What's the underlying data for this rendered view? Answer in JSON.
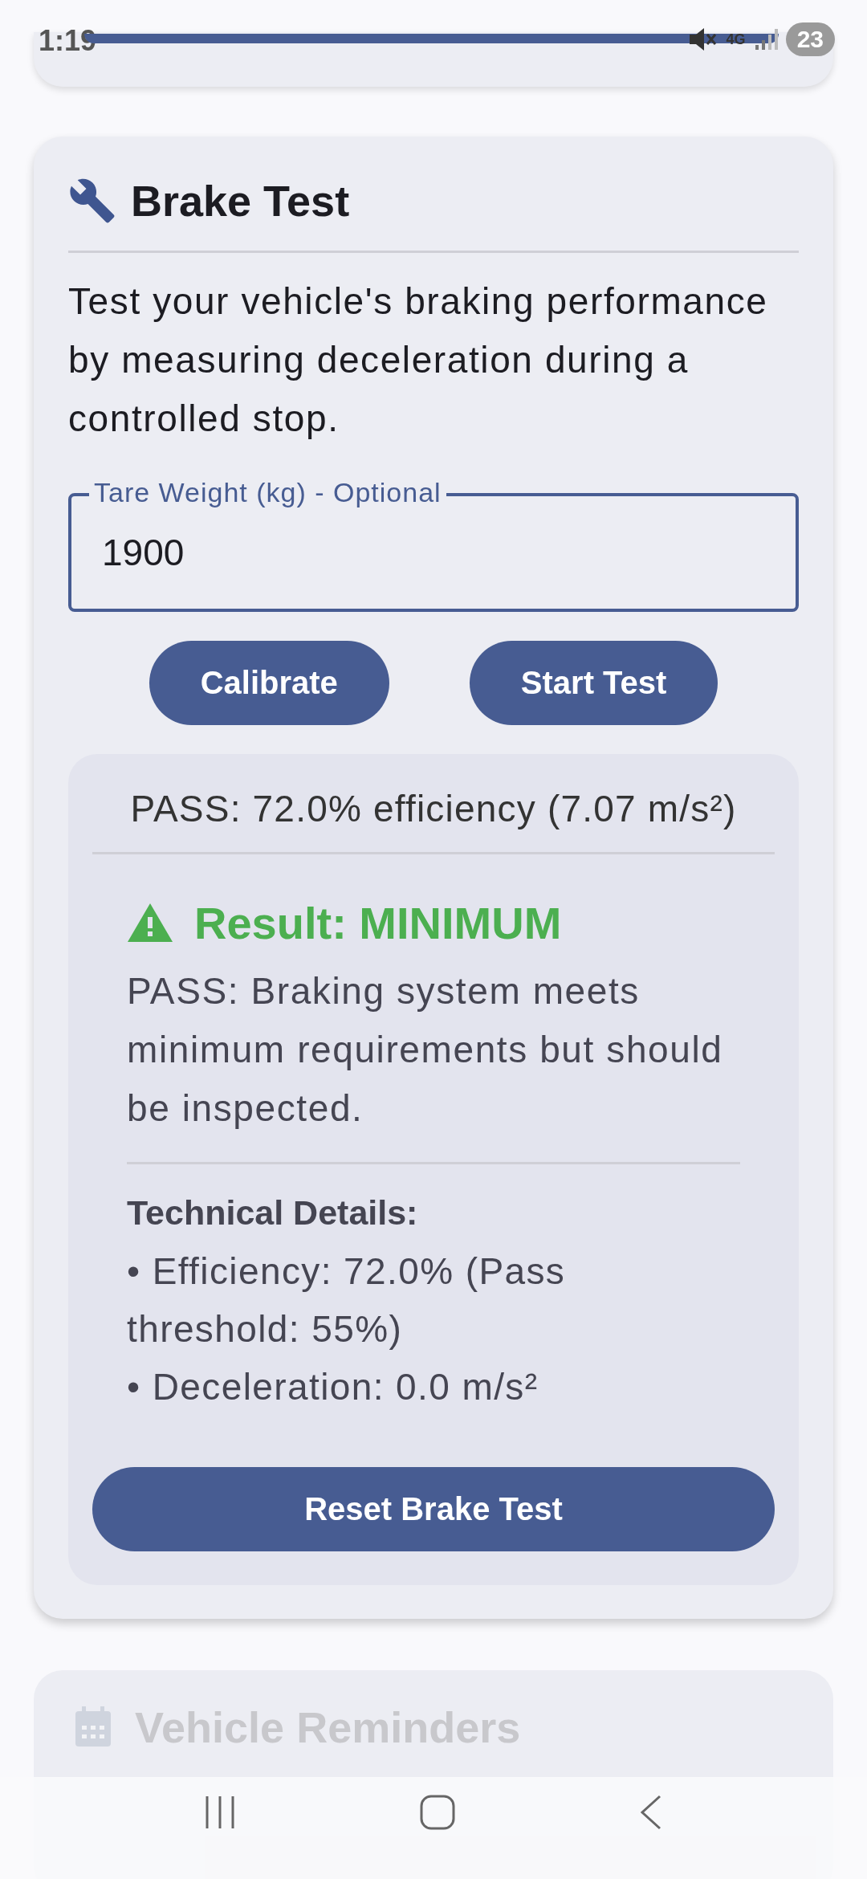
{
  "status_bar": {
    "time": "1:19",
    "network": "4G",
    "battery": "23"
  },
  "card": {
    "title": "Brake Test",
    "description": "Test your vehicle's braking performance by measuring deceleration during a controlled stop.",
    "field": {
      "label": "Tare Weight (kg) - Optional",
      "value": "1900"
    },
    "buttons": [
      "Calibrate",
      "Start Test"
    ],
    "result": {
      "summary": "PASS: 72.0% efficiency (7.07 m/s²)",
      "heading": "Result: MINIMUM",
      "message": "PASS: Braking system meets minimum requirements but should be inspected.",
      "details_title": "Technical Details:",
      "details": [
        "• Efficiency: 72.0% (Pass threshold: 55%)",
        "• Deceleration: 0.0 m/s²"
      ]
    },
    "reset_button": "Reset Brake Test"
  },
  "next_card": {
    "title": "Vehicle Reminders"
  }
}
